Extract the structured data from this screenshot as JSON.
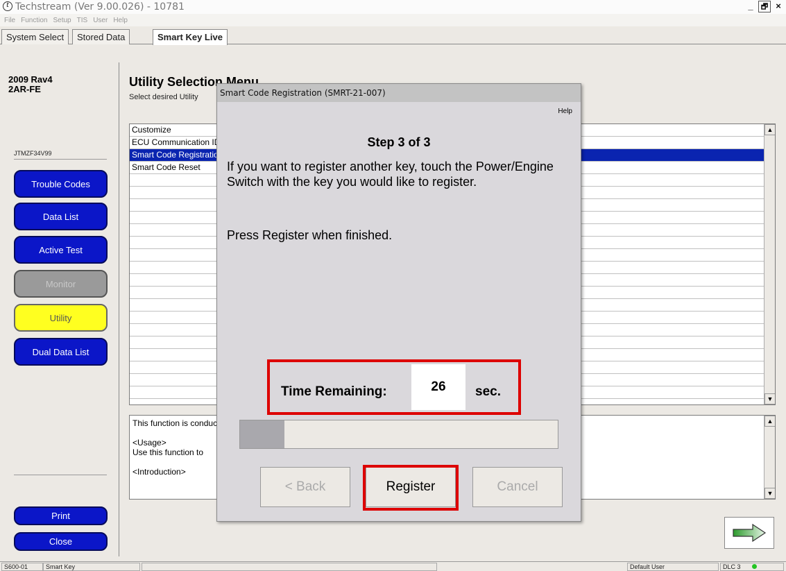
{
  "window": {
    "title": "Techstream (Ver 9.00.026) - 10781",
    "controls": [
      "_",
      "🗗",
      "×"
    ]
  },
  "menu": [
    "File",
    "Function",
    "Setup",
    "TIS",
    "User",
    "Help"
  ],
  "tabs": [
    "System Select",
    "Stored Data",
    "Smart Key Live"
  ],
  "left": {
    "model_line1": "2009 Rav4",
    "model_line2": "2AR-FE",
    "vin": "JTMZF34V99",
    "nav": [
      "Trouble Codes",
      "Data List",
      "Active Test",
      "Monitor",
      "Utility",
      "Dual Data List"
    ],
    "print": "Print",
    "close": "Close"
  },
  "main": {
    "title": "Utility Selection Menu",
    "subtitle": "Select desired Utility",
    "rows": [
      "Customize",
      "ECU Communication ID Registration (Diag Mode)",
      "Smart Code Registration",
      "Smart Code Reset"
    ],
    "desc": [
      "This function is conducted",
      "<Usage>",
      "Use this function to",
      "<Introduction>"
    ]
  },
  "dialog": {
    "title": "Smart Code Registration (SMRT-21-007)",
    "help": "Help",
    "step": "Step 3 of 3",
    "instruction": "If you want to register another key, touch the Power/Engine Switch with the key you would like to register.",
    "finish": "Press Register when finished.",
    "time_label": "Time Remaining:",
    "time_value": "26",
    "time_unit": "sec.",
    "progress_fraction": 0.14,
    "back": "< Back",
    "register": "Register",
    "cancel": "Cancel"
  },
  "status": {
    "code": "S600-01",
    "system": "Smart Key",
    "user": "Default User",
    "dlc": "DLC 3"
  },
  "colors": {
    "nav_blue": "#0b16c8",
    "utility_yellow": "#ffff20",
    "highlight_red": "#dd0000",
    "selection": "#0a24b0",
    "dlc_ok": "#22c422"
  }
}
